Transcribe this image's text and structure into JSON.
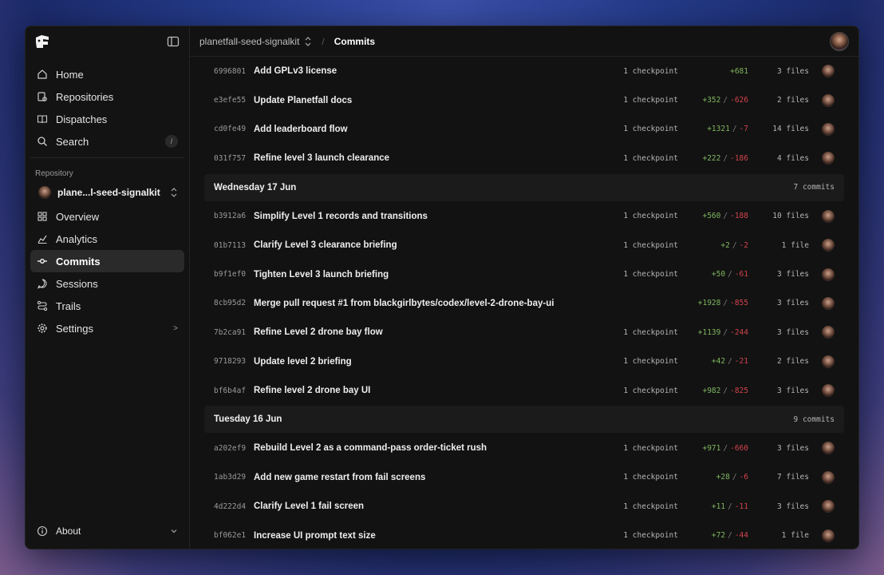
{
  "sidebar": {
    "nav": [
      {
        "label": "Home",
        "icon": "home-icon"
      },
      {
        "label": "Repositories",
        "icon": "repositories-icon"
      },
      {
        "label": "Dispatches",
        "icon": "book-icon"
      },
      {
        "label": "Search",
        "icon": "search-icon",
        "shortcut": "/"
      }
    ],
    "section_label": "Repository",
    "repo_name": "plane...l-seed-signalkit",
    "repo_nav": [
      {
        "label": "Overview",
        "icon": "grid-icon"
      },
      {
        "label": "Analytics",
        "icon": "chart-icon"
      },
      {
        "label": "Commits",
        "icon": "commit-icon",
        "active": true
      },
      {
        "label": "Sessions",
        "icon": "chat-icon"
      },
      {
        "label": "Trails",
        "icon": "route-icon"
      },
      {
        "label": "Settings",
        "icon": "gear-icon",
        "chevron": ">"
      }
    ],
    "about_label": "About"
  },
  "topbar": {
    "repo": "planetfall-seed-signalkit",
    "separator": "/",
    "page": "Commits"
  },
  "groups": [
    {
      "day": null,
      "rows": [
        {
          "hash": "6996801",
          "msg": "Add GPLv3 license",
          "cp": "1 checkpoint",
          "add": "+681",
          "del": null,
          "files": "3 files"
        },
        {
          "hash": "e3efe55",
          "msg": "Update Planetfall docs",
          "cp": "1 checkpoint",
          "add": "+352",
          "del": "-626",
          "files": "2 files"
        },
        {
          "hash": "cd0fe49",
          "msg": "Add leaderboard flow",
          "cp": "1 checkpoint",
          "add": "+1321",
          "del": "-7",
          "files": "14 files"
        },
        {
          "hash": "031f757",
          "msg": "Refine level 3 launch clearance",
          "cp": "1 checkpoint",
          "add": "+222",
          "del": "-186",
          "files": "4 files"
        }
      ]
    },
    {
      "day": "Wednesday 17 Jun",
      "count": "7 commits",
      "rows": [
        {
          "hash": "b3912a6",
          "msg": "Simplify Level 1 records and transitions",
          "cp": "1 checkpoint",
          "add": "+560",
          "del": "-188",
          "files": "10 files"
        },
        {
          "hash": "01b7113",
          "msg": "Clarify Level 3 clearance briefing",
          "cp": "1 checkpoint",
          "add": "+2",
          "del": "-2",
          "files": "1 file"
        },
        {
          "hash": "b9f1ef0",
          "msg": "Tighten Level 3 launch briefing",
          "cp": "1 checkpoint",
          "add": "+50",
          "del": "-61",
          "files": "3 files"
        },
        {
          "hash": "8cb95d2",
          "msg": "Merge pull request #1 from blackgirlbytes/codex/level-2-drone-bay-ui",
          "cp": "",
          "add": "+1928",
          "del": "-855",
          "files": "3 files"
        },
        {
          "hash": "7b2ca91",
          "msg": "Refine Level 2 drone bay flow",
          "cp": "1 checkpoint",
          "add": "+1139",
          "del": "-244",
          "files": "3 files"
        },
        {
          "hash": "9718293",
          "msg": "Update level 2 briefing",
          "cp": "1 checkpoint",
          "add": "+42",
          "del": "-21",
          "files": "2 files"
        },
        {
          "hash": "bf6b4af",
          "msg": "Refine level 2 drone bay UI",
          "cp": "1 checkpoint",
          "add": "+982",
          "del": "-825",
          "files": "3 files"
        }
      ]
    },
    {
      "day": "Tuesday 16 Jun",
      "count": "9 commits",
      "rows": [
        {
          "hash": "a202ef9",
          "msg": "Rebuild Level 2 as a command-pass order-ticket rush",
          "cp": "1 checkpoint",
          "add": "+971",
          "del": "-660",
          "files": "3 files"
        },
        {
          "hash": "1ab3d29",
          "msg": "Add new game restart from fail screens",
          "cp": "1 checkpoint",
          "add": "+28",
          "del": "-6",
          "files": "7 files"
        },
        {
          "hash": "4d222d4",
          "msg": "Clarify Level 1 fail screen",
          "cp": "1 checkpoint",
          "add": "+11",
          "del": "-11",
          "files": "3 files"
        },
        {
          "hash": "bf062e1",
          "msg": "Increase UI prompt text size",
          "cp": "1 checkpoint",
          "add": "+72",
          "del": "-44",
          "files": "1 file"
        }
      ]
    }
  ]
}
